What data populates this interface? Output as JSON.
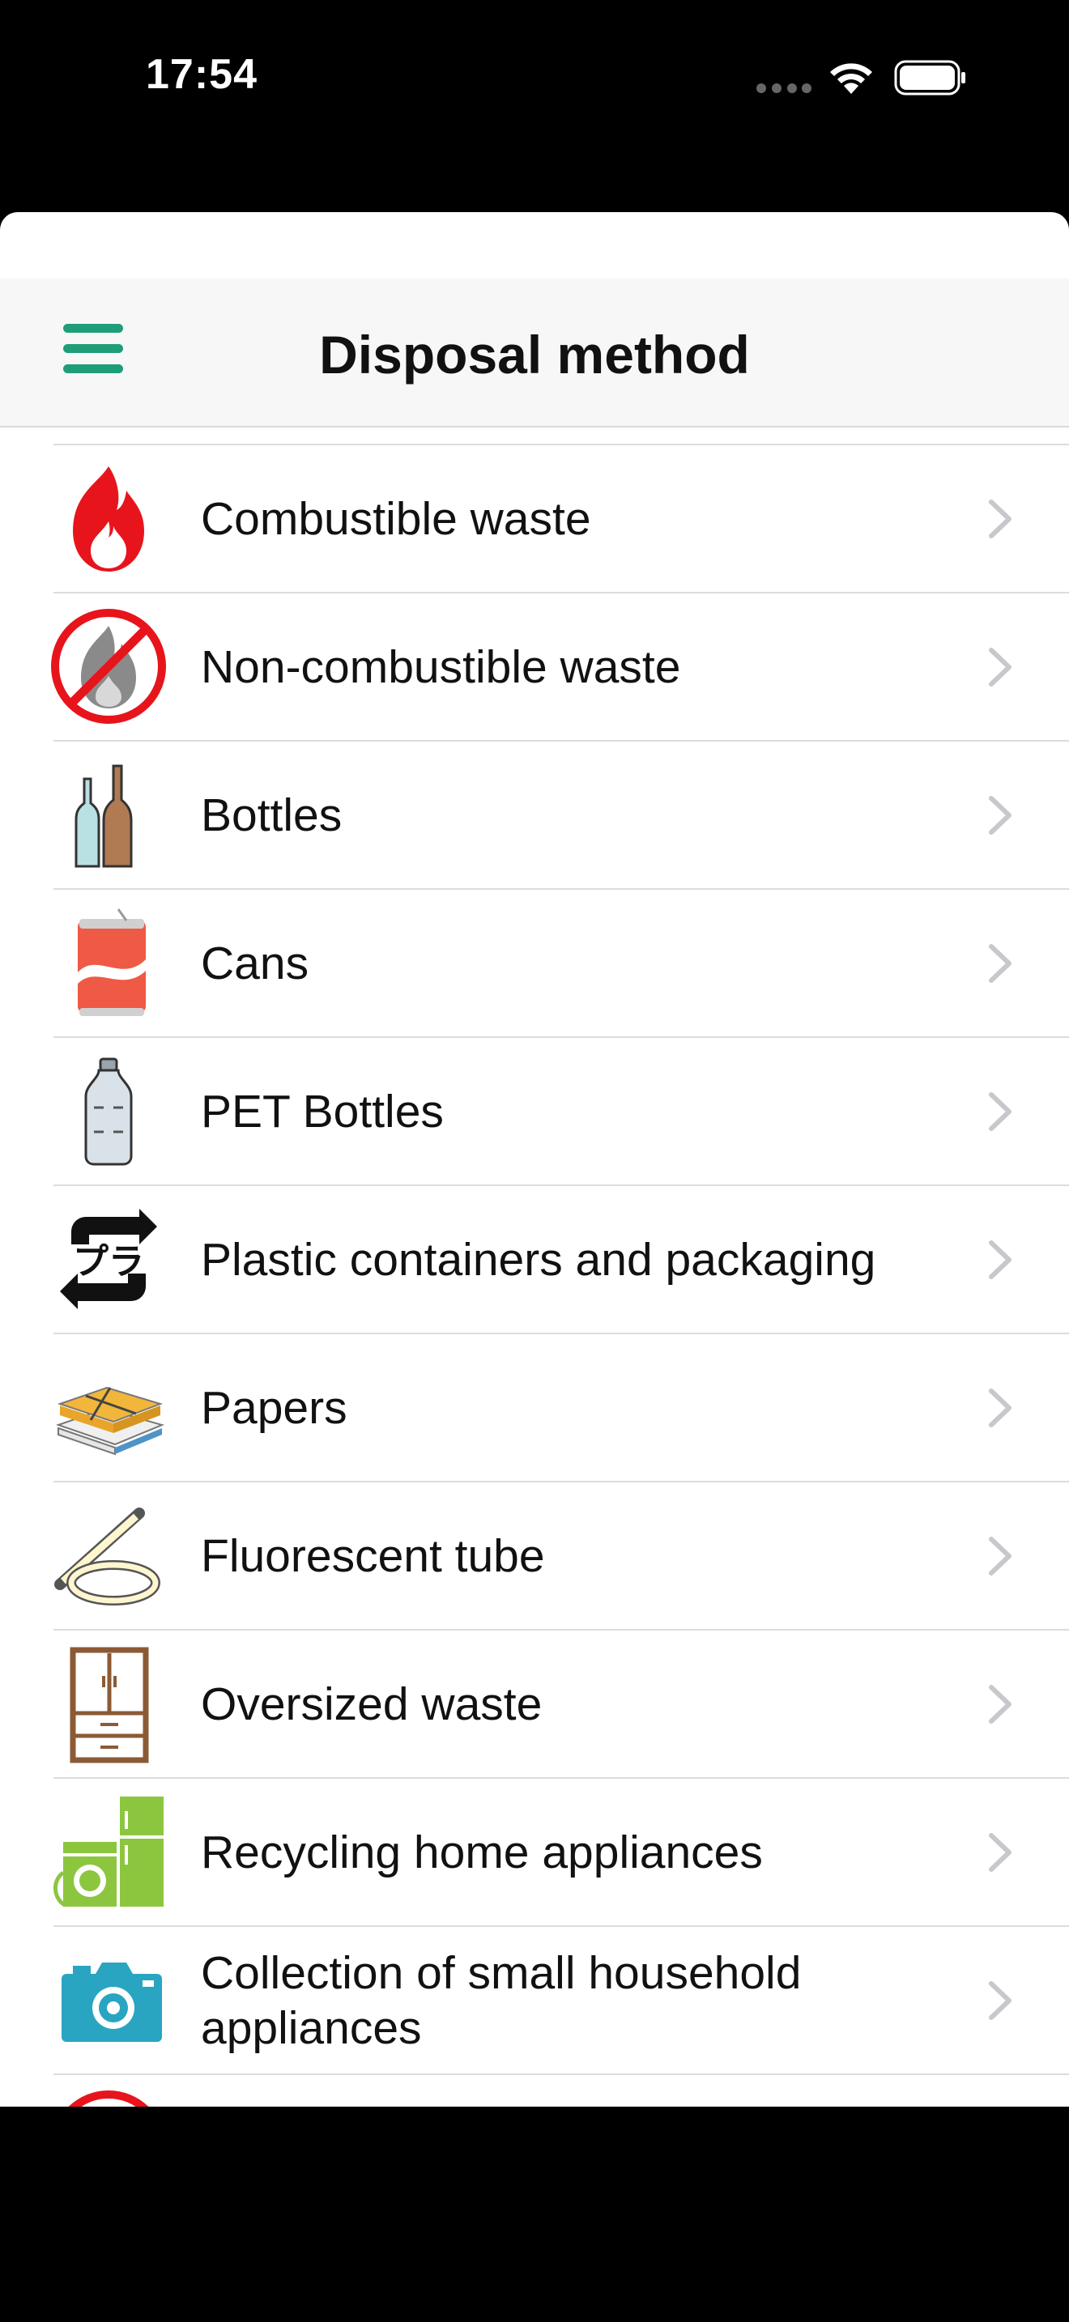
{
  "status_bar": {
    "time": "17:54"
  },
  "navbar": {
    "title": "Disposal method",
    "menu_icon": "hamburger-menu-icon",
    "accent": "#1f9d78"
  },
  "items": [
    {
      "label": "Combustible waste",
      "icon": "fire-icon"
    },
    {
      "label": "Non-combustible waste",
      "icon": "no-fire-icon"
    },
    {
      "label": "Bottles",
      "icon": "glass-bottles-icon"
    },
    {
      "label": "Cans",
      "icon": "can-icon"
    },
    {
      "label": "PET Bottles",
      "icon": "pet-bottle-icon"
    },
    {
      "label": "Plastic containers and packaging",
      "icon": "plastic-recycle-mark-icon"
    },
    {
      "label": "Papers",
      "icon": "paper-bundle-icon"
    },
    {
      "label": "Fluorescent tube",
      "icon": "fluorescent-tube-icon"
    },
    {
      "label": "Oversized waste",
      "icon": "wardrobe-icon"
    },
    {
      "label": "Recycling home appliances",
      "icon": "home-appliances-icon"
    },
    {
      "label": "Collection of small household appliances",
      "icon": "camera-icon"
    }
  ]
}
